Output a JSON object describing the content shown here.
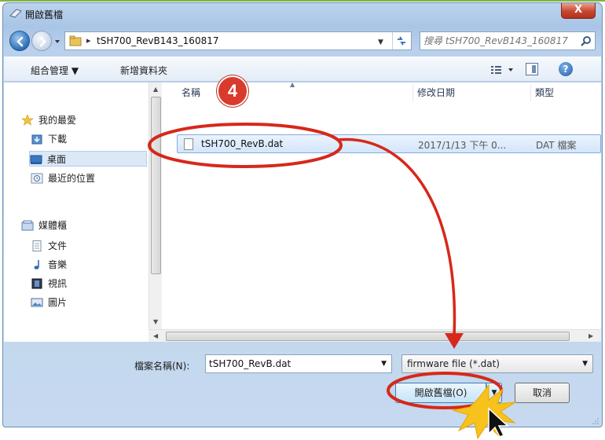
{
  "window": {
    "title": "開啟舊檔",
    "close_label": "X"
  },
  "address": {
    "path_segment": "tSH700_RevB143_160817",
    "search_placeholder": "搜尋 tSH700_RevB143_160817"
  },
  "toolbar": {
    "organize_label": "組合管理 ▼",
    "new_folder_label": "新增資料夾",
    "help_label": "?"
  },
  "nav": {
    "favorites": "我的最愛",
    "downloads": "下載",
    "desktop": "桌面",
    "recent": "最近的位置",
    "libraries": "媒體櫃",
    "documents": "文件",
    "music": "音樂",
    "videos": "視訊",
    "pictures": "圖片"
  },
  "columns": {
    "name": "名稱",
    "date": "修改日期",
    "type": "類型"
  },
  "files": [
    {
      "name": "tSH700_RevB.dat",
      "date": "2017/1/13 下午 0...",
      "type": "DAT 檔案"
    }
  ],
  "footer": {
    "filename_label": "檔案名稱(N):",
    "filename_value": "tSH700_RevB.dat",
    "filetype_value": "firmware file (*.dat)",
    "open_label": "開啟舊檔(O)",
    "cancel_label": "取消"
  },
  "annotation": {
    "step_number": "4"
  },
  "colors": {
    "annotation_red": "#d6281b",
    "selection_blue": "#d4e6fb",
    "window_frame": "#a9c5e6"
  }
}
